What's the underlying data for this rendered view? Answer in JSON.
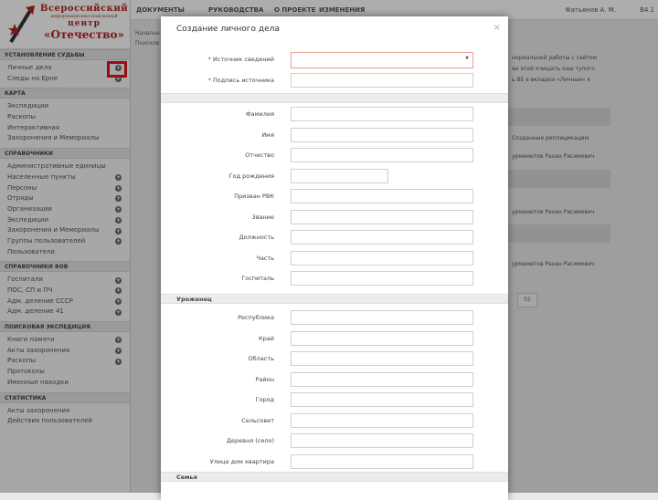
{
  "logo": {
    "line1": "Всероссийский",
    "line2": "информационно-поисковый",
    "line3": "центр",
    "line4": "«Отечество»"
  },
  "topbar": {
    "nav": [
      "ДОКУМЕНТЫ",
      "РУКОВОДСТВА",
      "О ПРОЕКТЕ",
      "ИЗМЕНЕНИЯ"
    ],
    "user": "Фатьянов А. М.",
    "version": "В4.1"
  },
  "breadcrumb": [
    "Начальн",
    "Поисков"
  ],
  "sidebar": {
    "sections": [
      {
        "title": "УСТАНОВЛЕНИЕ СУДЬБЫ",
        "items": [
          {
            "label": "Личные дела",
            "plus": true
          },
          {
            "label": "Следы на Ерне",
            "plus": true
          }
        ]
      },
      {
        "title": "КАРТА",
        "items": [
          {
            "label": "Экспедиции",
            "plus": false
          },
          {
            "label": "Раскопы",
            "plus": false
          },
          {
            "label": "Интерактивная",
            "plus": false
          },
          {
            "label": "Захоронения и Мемориалы",
            "plus": false
          }
        ]
      },
      {
        "title": "СПРАВОЧНИКИ",
        "items": [
          {
            "label": "Административные единицы",
            "plus": false
          },
          {
            "label": "Населенные пункты",
            "plus": true
          },
          {
            "label": "Персоны",
            "plus": true
          },
          {
            "label": "Отряды",
            "plus": true
          },
          {
            "label": "Организации",
            "plus": true
          },
          {
            "label": "Экспедиции",
            "plus": true
          },
          {
            "label": "Захоронения и Мемориалы",
            "plus": true
          },
          {
            "label": "Группы пользователей",
            "plus": true
          },
          {
            "label": "Пользователи",
            "plus": false
          }
        ]
      },
      {
        "title": "СПРАВОЧНИКИ ВОВ",
        "items": [
          {
            "label": "Госпитали",
            "plus": true
          },
          {
            "label": "ПОС, СП и ПЧ",
            "plus": true
          },
          {
            "label": "Адм. деление СССР",
            "plus": true
          },
          {
            "label": "Адм. деление 41",
            "plus": true
          }
        ]
      },
      {
        "title": "ПОИСКОВАЯ ЭКСПЕДИЦИЯ",
        "items": [
          {
            "label": "Книги памяти",
            "plus": true
          },
          {
            "label": "Акты захоронения",
            "plus": true
          },
          {
            "label": "Раскопы",
            "plus": true
          },
          {
            "label": "Протоколы",
            "plus": false
          },
          {
            "label": "Именные находки",
            "plus": false
          }
        ]
      },
      {
        "title": "СТАТИСТИКА",
        "items": [
          {
            "label": "Акты захоронения",
            "plus": false
          },
          {
            "label": "Действия пользователей",
            "plus": false
          }
        ]
      }
    ]
  },
  "background": {
    "lines": [
      "нормальной работы с сайтом",
      "ан этой очищать кэш тупого",
      "ь ВЕ в вкладки «Личные» к",
      "Созданные реплицикацим",
      "урмаметов Рахан Расимович",
      "урмаметов Рахан Расимович",
      "урмаметов Рахан Расимович"
    ],
    "page_button": "55"
  },
  "modal": {
    "title": "Создание личного дела",
    "close": "×",
    "source_fields": [
      {
        "label": "Источник сведений",
        "required": true,
        "type": "select",
        "value": ""
      },
      {
        "label": "Подпись источника",
        "required": true,
        "type": "text",
        "value": ""
      }
    ],
    "person_fields": [
      "Фамилия",
      "Имя",
      "Отчество",
      "Год рождения",
      "Призван РВК",
      "Звание",
      "Должность",
      "Часть",
      "Госпиталь"
    ],
    "birthplace_title": "Уроженец",
    "birthplace_fields": [
      "Республика",
      "Край",
      "Область",
      "Район",
      "Город",
      "Сельсовет",
      "Деревня (село)",
      "Улица дом квартира"
    ],
    "family_title": "Семья"
  },
  "colors": {
    "accent_red": "#b3261e",
    "highlight": "#e0141c"
  }
}
